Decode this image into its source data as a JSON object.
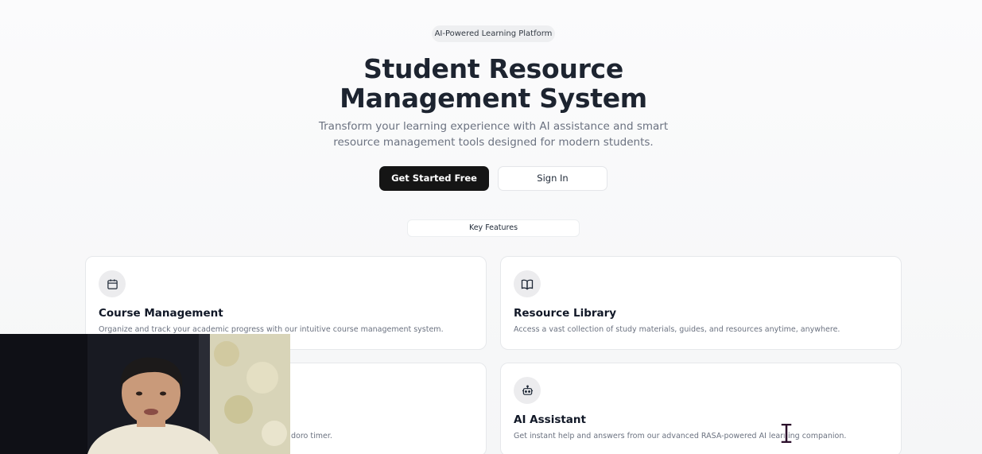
{
  "hero": {
    "badge": "AI-Powered Learning Platform",
    "title_line1": "Student Resource",
    "title_line2": "Management System",
    "subtitle_line1": "Transform your learning experience with AI assistance and smart",
    "subtitle_line2": "resource management tools designed for modern students.",
    "primary_button": "Get Started Free",
    "secondary_button": "Sign In"
  },
  "features": {
    "tab_label": "Key Features",
    "cards": [
      {
        "title": "Course Management",
        "description": "Organize and track your academic progress with our intuitive course management system.",
        "icon": "calendar-icon"
      },
      {
        "title": "Resource Library",
        "description": "Access a vast collection of study materials, guides, and resources anytime, anywhere.",
        "icon": "book-icon"
      },
      {
        "title": "",
        "description": "doro timer.",
        "icon": ""
      },
      {
        "title": "AI Assistant",
        "description": "Get instant help and answers from our advanced RASA-powered AI learning companion.",
        "icon": "robot-icon"
      }
    ]
  },
  "colors": {
    "primary_button_bg": "#151515",
    "title_text": "#1d2430",
    "muted_text": "#6b7280"
  }
}
